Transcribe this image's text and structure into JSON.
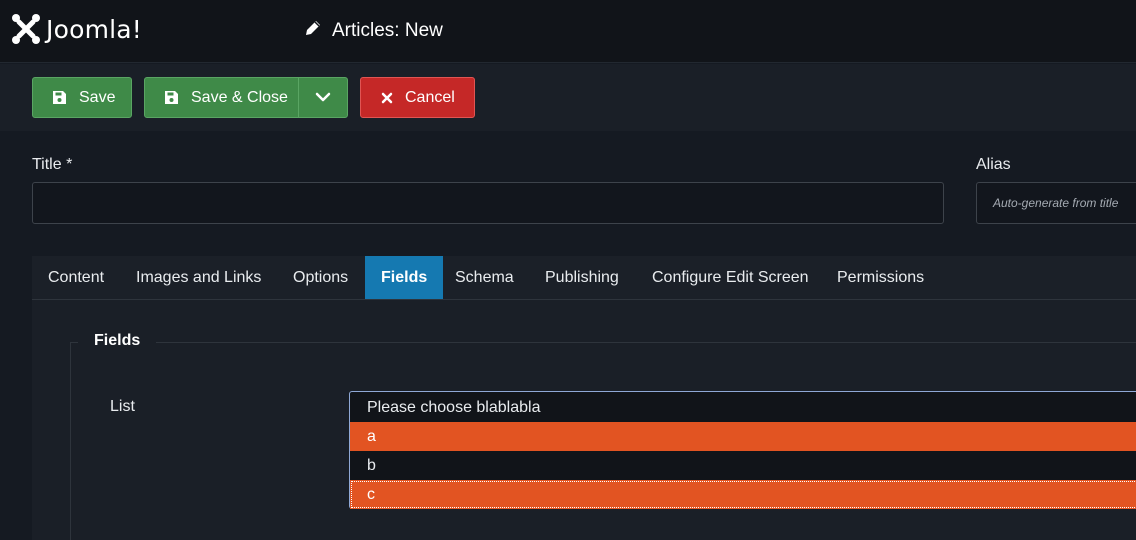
{
  "brand": {
    "name": "Joomla!"
  },
  "header": {
    "title": "Articles: New",
    "icon": "pencil-icon"
  },
  "toolbar": {
    "save_label": "Save",
    "save_close_label": "Save & Close",
    "cancel_label": "Cancel"
  },
  "form": {
    "title_label": "Title *",
    "title_value": "",
    "alias_label": "Alias",
    "alias_placeholder": "Auto-generate from title"
  },
  "tabs": [
    {
      "label": "Content"
    },
    {
      "label": "Images and Links"
    },
    {
      "label": "Options"
    },
    {
      "label": "Fields",
      "active": true
    },
    {
      "label": "Schema"
    },
    {
      "label": "Publishing"
    },
    {
      "label": "Configure Edit Screen"
    },
    {
      "label": "Permissions"
    }
  ],
  "fields": {
    "legend": "Fields",
    "list_label": "List",
    "options": [
      {
        "label": "Please choose blablabla",
        "selected": false
      },
      {
        "label": "a",
        "selected": true
      },
      {
        "label": "b",
        "selected": false
      },
      {
        "label": "c",
        "selected": true
      }
    ]
  },
  "colors": {
    "save_green": "#3f8a48",
    "cancel_red": "#c52827",
    "active_tab_blue": "#1579b1",
    "selected_option_orange": "#e25422"
  }
}
